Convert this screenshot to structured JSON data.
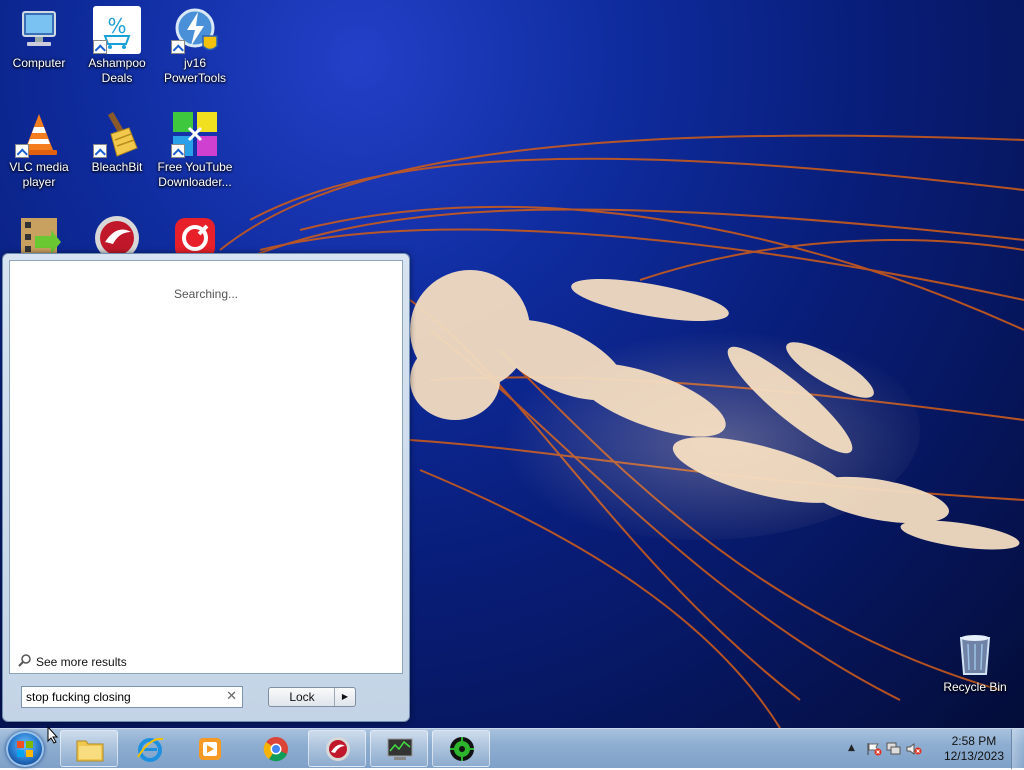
{
  "desktop": {
    "icons": [
      {
        "label": "Computer",
        "icon": "computer-icon"
      },
      {
        "label": "Ashampoo Deals",
        "icon": "ashampoo-deals-icon"
      },
      {
        "label": "jv16 PowerTools",
        "icon": "jv16-powertools-icon"
      },
      {
        "label": "VLC media player",
        "icon": "vlc-icon"
      },
      {
        "label": "BleachBit",
        "icon": "bleachbit-icon"
      },
      {
        "label": "Free YouTube Downloader...",
        "icon": "youtube-downloader-icon"
      },
      {
        "label": "",
        "icon": "video-converter-icon"
      },
      {
        "label": "",
        "icon": "red-app-icon"
      },
      {
        "label": "",
        "icon": "red-app-2-icon"
      },
      {
        "label": "Recycle Bin",
        "icon": "recycle-bin-icon"
      }
    ]
  },
  "start_menu": {
    "status": "Searching...",
    "see_more": "See more results",
    "search_value": "stop fucking closing",
    "lock_label": "Lock"
  },
  "taskbar": {
    "pinned": [
      "file-explorer-icon",
      "internet-explorer-icon",
      "media-player-icon",
      "chrome-icon",
      "red-app-icon",
      "task-manager-icon",
      "green-virus-app-icon"
    ],
    "clock_time": "2:58 PM",
    "clock_date": "12/13/2023"
  },
  "colors": {
    "desktop_bg": "#0f2c9e",
    "taskbar": "#8eaed1",
    "jellyfish": "#f3dcc0",
    "tentacle": "#d06020"
  }
}
